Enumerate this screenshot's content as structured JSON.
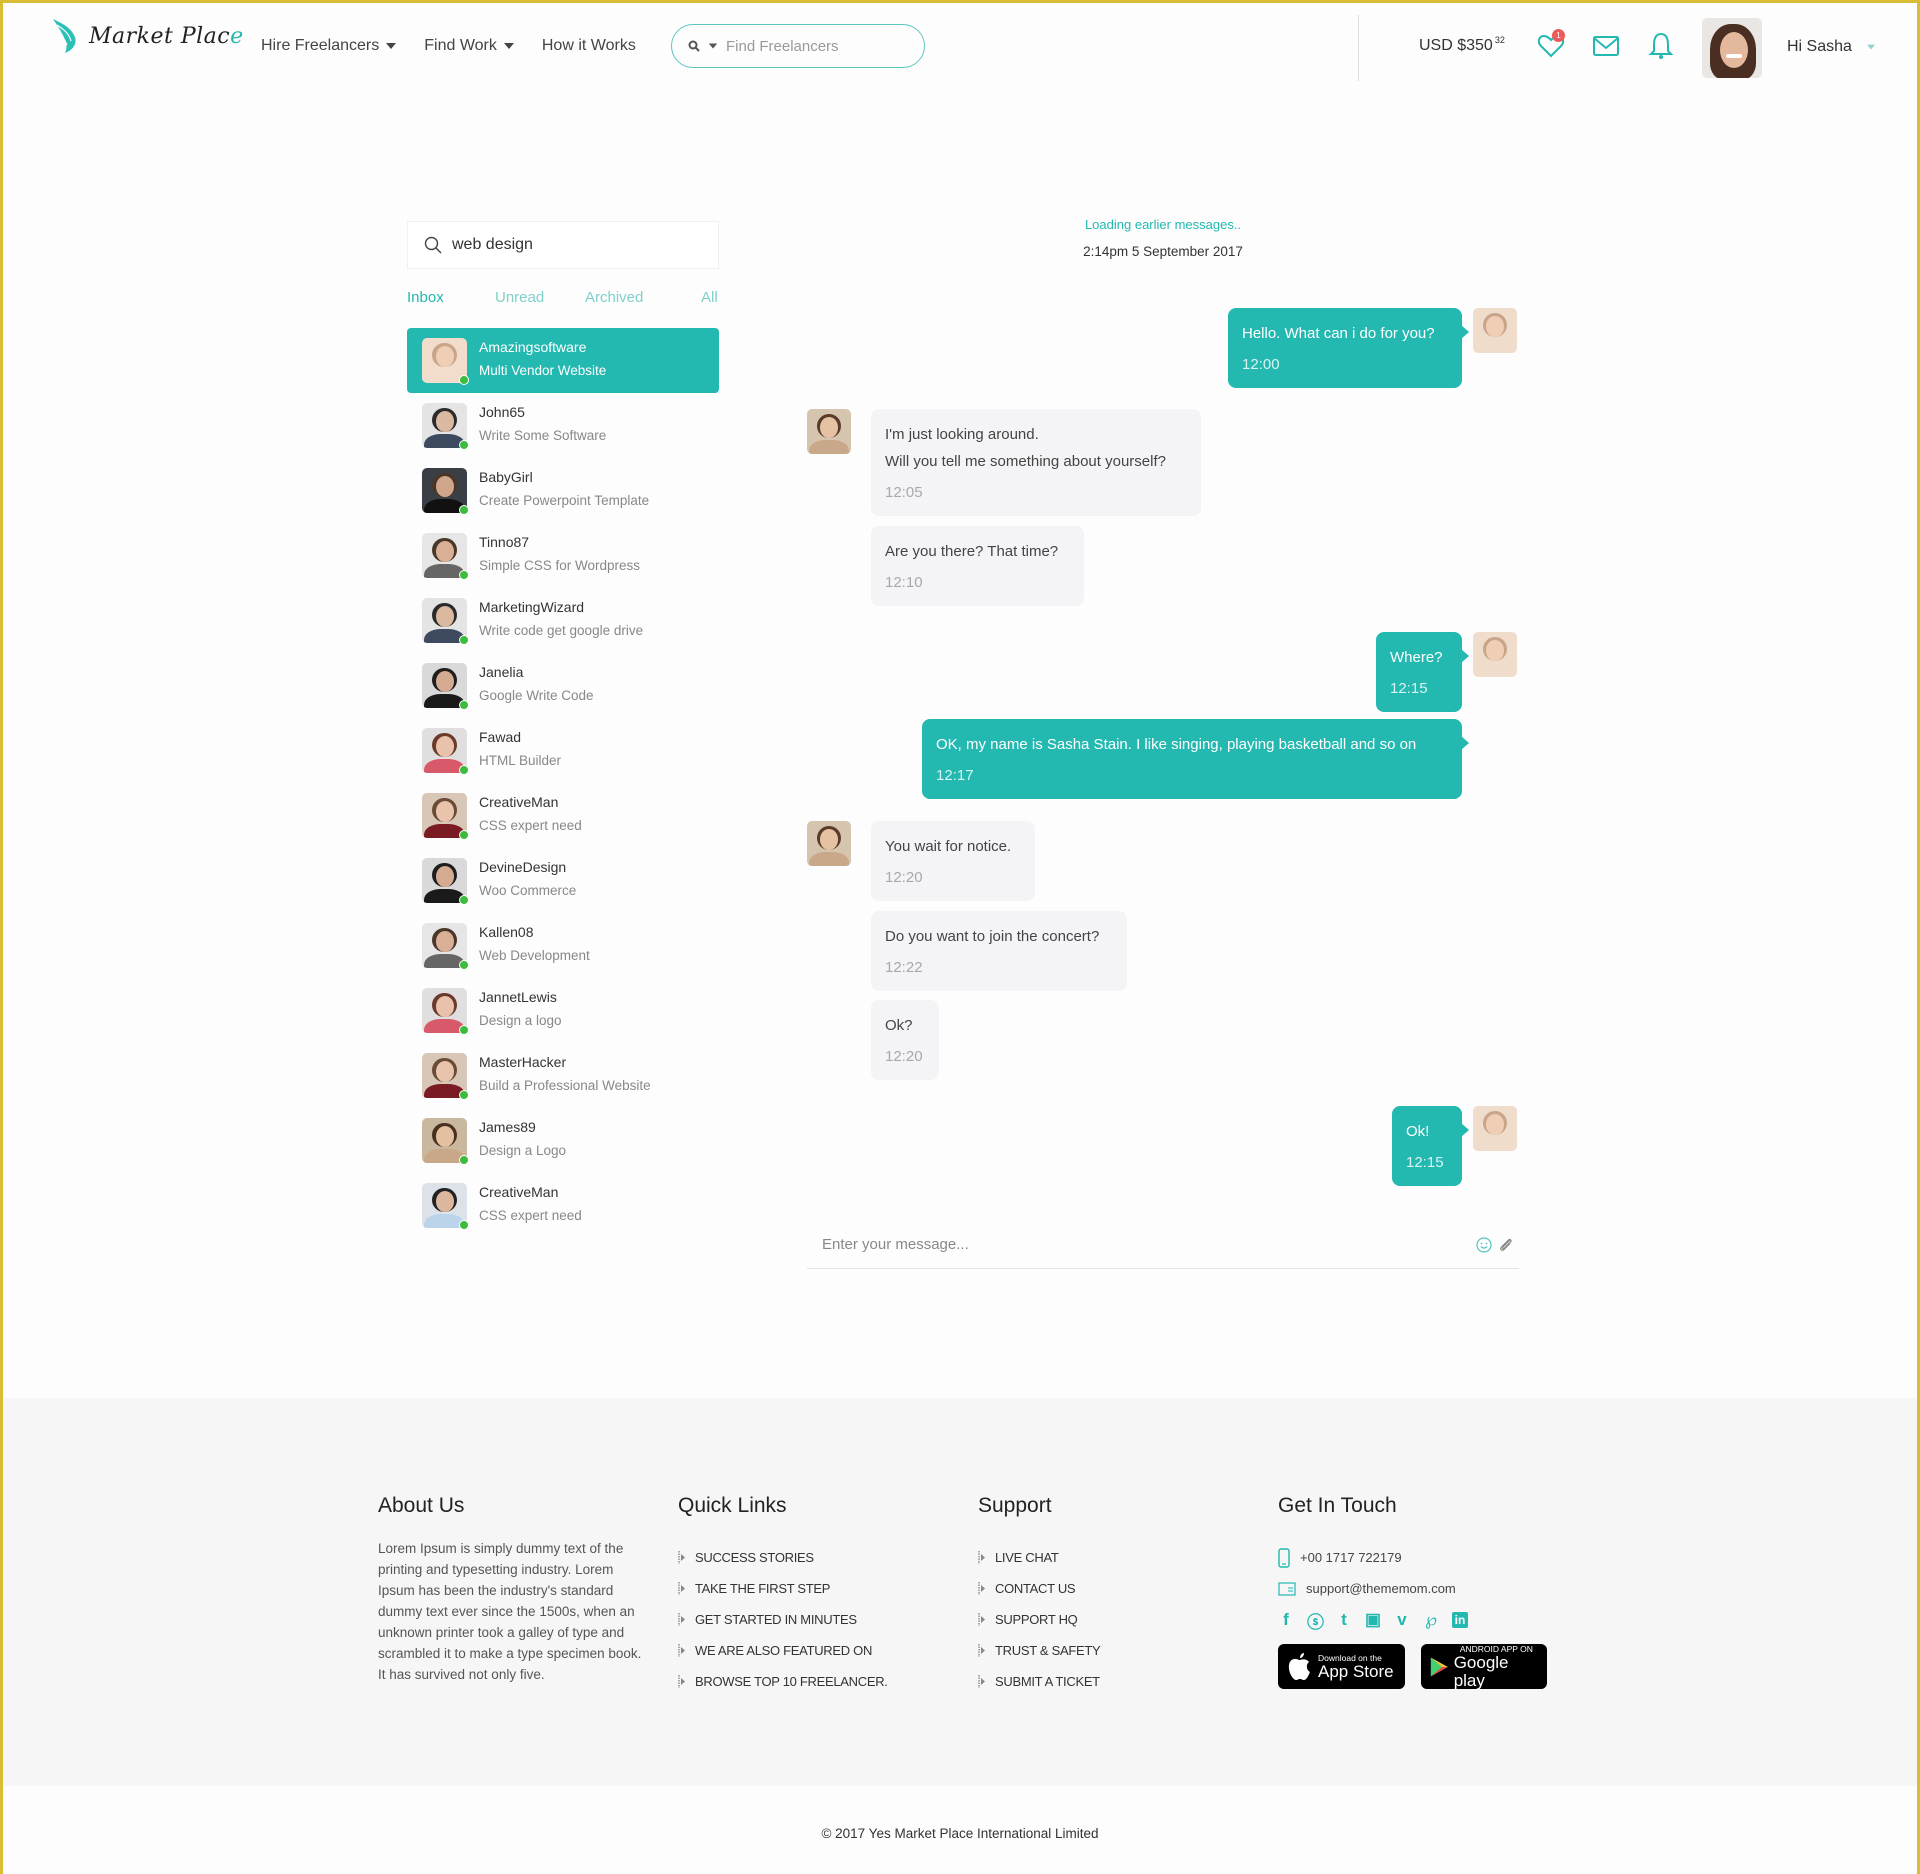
{
  "header": {
    "logo_text": "Market Place",
    "nav": [
      {
        "label": "Hire Freelancers",
        "has_dropdown": true
      },
      {
        "label": "Find Work",
        "has_dropdown": true
      },
      {
        "label": "How it Works",
        "has_dropdown": false
      }
    ],
    "search_placeholder": "Find Freelancers",
    "balance": "USD $350",
    "balance_cents": "32",
    "favorites_badge": "1",
    "greeting": "Hi Sasha",
    "icons": [
      "heart-icon",
      "mail-icon",
      "bell-icon"
    ]
  },
  "sidebar": {
    "search_value": "web design",
    "tabs": [
      {
        "label": "Inbox",
        "active": true
      },
      {
        "label": "Unread",
        "active": false
      },
      {
        "label": "Archived",
        "active": false
      },
      {
        "label": "All",
        "active": false
      }
    ],
    "conversations": [
      {
        "name": "Amazingsoftware",
        "subject": "Multi Vendor Website",
        "online": true,
        "active": true
      },
      {
        "name": "John65",
        "subject": "Write Some Software",
        "online": true
      },
      {
        "name": "BabyGirl",
        "subject": "Create Powerpoint Template",
        "online": true
      },
      {
        "name": "Tinno87",
        "subject": "Simple CSS for Wordpress",
        "online": true
      },
      {
        "name": "MarketingWizard",
        "subject": "Write code get google drive",
        "online": true
      },
      {
        "name": "Janelia",
        "subject": "Google Write Code",
        "online": true
      },
      {
        "name": "Fawad",
        "subject": "HTML Builder",
        "online": true
      },
      {
        "name": "CreativeMan",
        "subject": "CSS expert need",
        "online": true
      },
      {
        "name": "DevineDesign",
        "subject": "Woo Commerce",
        "online": true
      },
      {
        "name": "Kallen08",
        "subject": "Web Development",
        "online": true
      },
      {
        "name": "JannetLewis",
        "subject": "Design a logo",
        "online": true
      },
      {
        "name": "MasterHacker",
        "subject": "Build a Professional Website",
        "online": true
      },
      {
        "name": "James89",
        "subject": "Design a Logo",
        "online": true
      },
      {
        "name": "CreativeMan",
        "subject": "CSS expert need",
        "online": true
      }
    ]
  },
  "chat": {
    "loading_text": "Loading earlier messages..",
    "date": "2:14pm 5 September 2017",
    "messages": [
      {
        "direction": "out",
        "lines": [
          "Hello. What can i do for you?"
        ],
        "time": "12:00"
      },
      {
        "direction": "in",
        "lines": [
          "I'm just looking around.",
          "Will you tell me something about yourself?"
        ],
        "time": "12:05"
      },
      {
        "direction": "in",
        "lines": [
          "Are you there? That time?"
        ],
        "time": "12:10"
      },
      {
        "direction": "out",
        "lines": [
          "Where?"
        ],
        "time": "12:15"
      },
      {
        "direction": "out",
        "lines": [
          "OK, my name is Sasha Stain. I like singing, playing basketball and so on"
        ],
        "time": "12:17"
      },
      {
        "direction": "in",
        "lines": [
          "You wait for notice."
        ],
        "time": "12:20"
      },
      {
        "direction": "in",
        "lines": [
          "Do you want to join the concert?"
        ],
        "time": "12:22"
      },
      {
        "direction": "in",
        "lines": [
          "Ok?"
        ],
        "time": "12:20"
      },
      {
        "direction": "out",
        "lines": [
          "Ok!"
        ],
        "time": "12:15"
      }
    ],
    "composer_placeholder": "Enter your message..."
  },
  "footer": {
    "about": {
      "title": "About Us",
      "text": "Lorem Ipsum is simply dummy text of the printing and typesetting industry. Lorem Ipsum has been the industry's standard dummy text ever since the 1500s, when an unknown printer took a galley of type and scrambled it to make a type specimen book. It has survived not only five."
    },
    "quick_links": {
      "title": "Quick Links",
      "items": [
        "SUCCESS STORIES",
        "TAKE THE FIRST STEP",
        "GET STARTED IN MINUTES",
        "WE ARE ALSO FEATURED ON",
        "BROWSE TOP 10 FREELANCER."
      ]
    },
    "support": {
      "title": "Support",
      "items": [
        "LIVE CHAT",
        "CONTACT US",
        "SUPPORT HQ",
        "TRUST & SAFETY",
        "SUBMIT A TICKET"
      ]
    },
    "contact": {
      "title": "Get In Touch",
      "phone": "+00 1717 722179",
      "email": "support@thememom.com",
      "social": [
        "facebook",
        "skype",
        "tumblr",
        "youtube",
        "vimeo",
        "pinterest",
        "linkedin"
      ],
      "app_store": {
        "small": "Download on the",
        "big": "App Store"
      },
      "google_play": {
        "small": "ANDROID APP ON",
        "big": "Google play"
      }
    },
    "copyright": "© 2017 Yes Market Place International Limited"
  },
  "colors": {
    "accent": "#23b8b0",
    "border_frame": "#d9bd34",
    "online": "#3dbb3d",
    "badge": "#ec5b5b"
  }
}
